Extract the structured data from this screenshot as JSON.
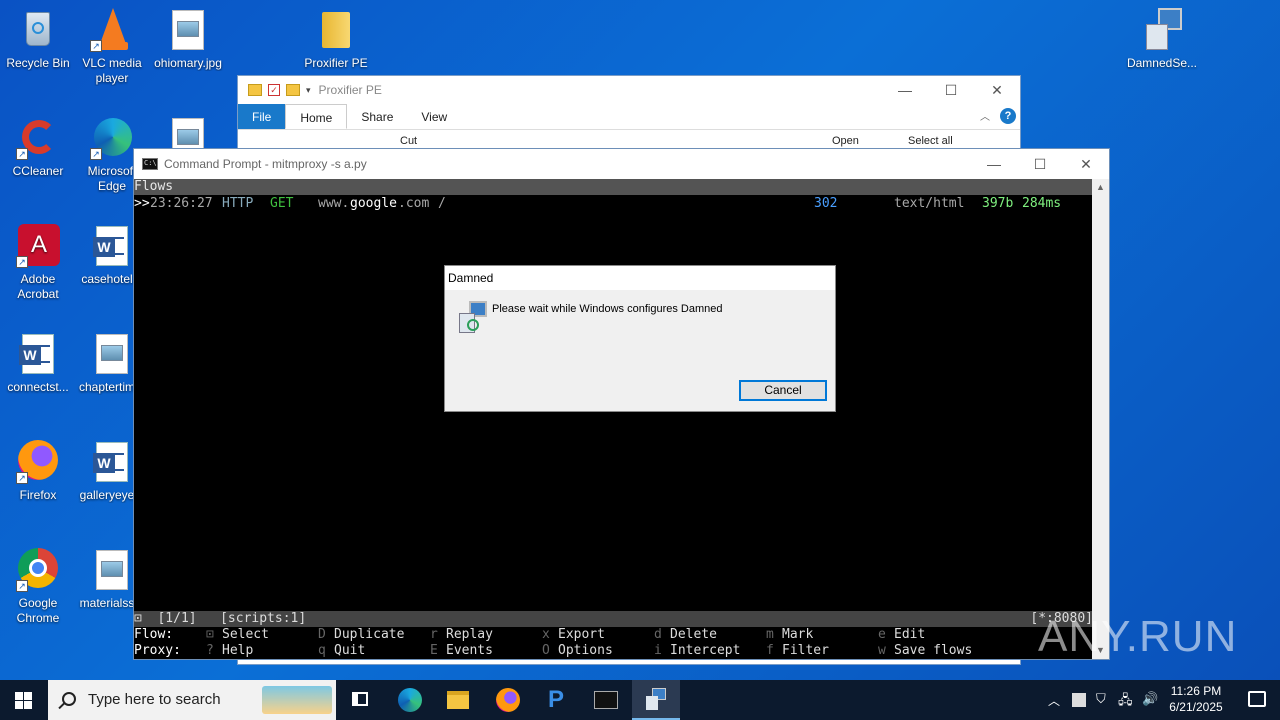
{
  "desktop": {
    "icons": [
      {
        "label": "Recycle Bin"
      },
      {
        "label": "VLC media player"
      },
      {
        "label": "ohiomary.jpg"
      },
      {
        "label": "Proxifier PE"
      },
      {
        "label": "DamnedSe..."
      },
      {
        "label": "CCleaner"
      },
      {
        "label": "Microsoft Edge"
      },
      {
        "label": "Adobe Acrobat"
      },
      {
        "label": "casehotel..."
      },
      {
        "label": "connectst..."
      },
      {
        "label": "chaptertim..."
      },
      {
        "label": "Firefox"
      },
      {
        "label": "galleryeye..."
      },
      {
        "label": "Google Chrome"
      },
      {
        "label": "materialss..."
      }
    ]
  },
  "explorer": {
    "title": "Proxifier PE",
    "tabs": [
      "File",
      "Home",
      "Share",
      "View"
    ],
    "tools": {
      "cut": "Cut",
      "open": "Open",
      "select_all": "Select all"
    },
    "help": "?"
  },
  "cmd": {
    "title": "Command Prompt - mitmproxy  -s a.py",
    "header": "Flows",
    "flow": {
      "marker": ">>",
      "time": "23:26:27",
      "proto": "HTTP",
      "method": "GET",
      "host_prefix": "www.",
      "host_mid": "google",
      "host_suffix": ".com",
      "path": "/",
      "status": "302",
      "ctype": "text/html",
      "size": "397b",
      "duration": "284ms"
    },
    "statusbar": {
      "left": "⊡  [1/1]   [scripts:1]",
      "right": "[*:8080]"
    },
    "keys": {
      "flow_label": "Flow:",
      "proxy_label": "Proxy:",
      "row1": [
        {
          "key": "⊡",
          "label": "Select"
        },
        {
          "key": "D",
          "label": "Duplicate"
        },
        {
          "key": "r",
          "label": "Replay"
        },
        {
          "key": "x",
          "label": "Export"
        },
        {
          "key": "d",
          "label": "Delete"
        },
        {
          "key": "m",
          "label": "Mark"
        },
        {
          "key": "e",
          "label": "Edit"
        }
      ],
      "row2": [
        {
          "key": "?",
          "label": "Help"
        },
        {
          "key": "q",
          "label": "Quit"
        },
        {
          "key": "E",
          "label": "Events"
        },
        {
          "key": "O",
          "label": "Options"
        },
        {
          "key": "i",
          "label": "Intercept"
        },
        {
          "key": "f",
          "label": "Filter"
        },
        {
          "key": "w",
          "label": "Save flows"
        }
      ]
    }
  },
  "dialog": {
    "title": "Damned",
    "message": "Please wait while Windows configures Damned",
    "cancel": "Cancel"
  },
  "watermark": "ANY.RUN",
  "taskbar": {
    "search_placeholder": "Type here to search",
    "time": "11:26 PM",
    "date": "6/21/2025"
  },
  "colors": {
    "desktop": "#0b6fd6",
    "console_bg": "#000000",
    "accent": "#0078d7"
  }
}
